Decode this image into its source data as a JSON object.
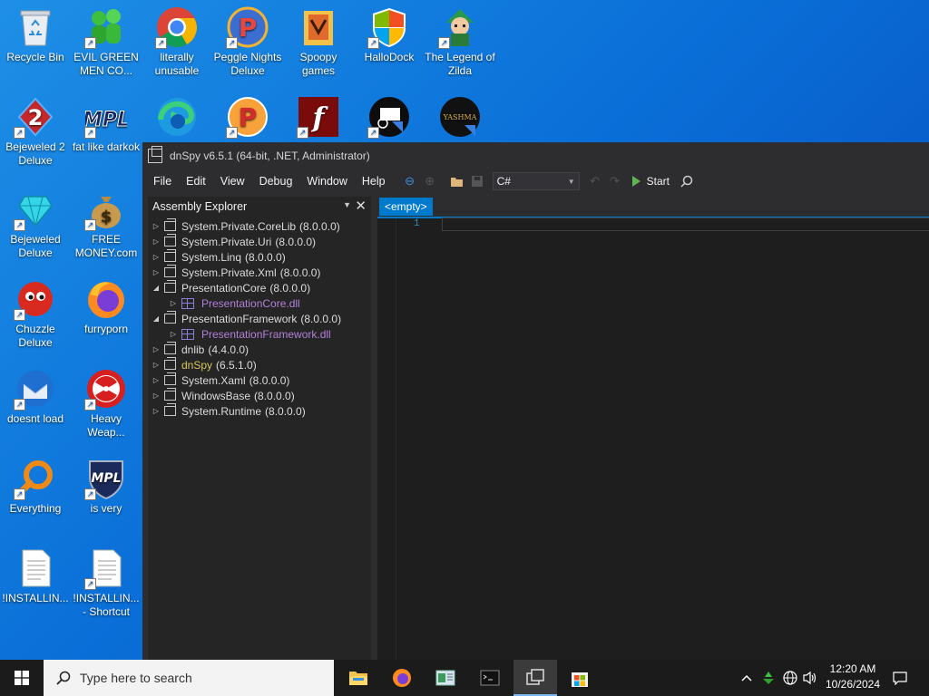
{
  "desktop": {
    "icons": [
      {
        "label": "Recycle Bin"
      },
      {
        "label": "EVIL GREEN MEN CO..."
      },
      {
        "label": "literally unusable"
      },
      {
        "label": "Peggle Nights Deluxe"
      },
      {
        "label": "Spoopy games"
      },
      {
        "label": "HalloDock"
      },
      {
        "label": "The Legend of Zilda"
      },
      {
        "label": "Bejeweled 2 Deluxe"
      },
      {
        "label": "fat like darkok"
      },
      {
        "label": "Bejeweled Deluxe"
      },
      {
        "label": "FREE MONEY.com"
      },
      {
        "label": "Chuzzle Deluxe"
      },
      {
        "label": "furryporn"
      },
      {
        "label": "doesnt load"
      },
      {
        "label": "Heavy Weap..."
      },
      {
        "label": "Everything"
      },
      {
        "label": "is very"
      },
      {
        "label": "!INSTALLIN..."
      },
      {
        "label": "!INSTALLIN... - Shortcut"
      }
    ],
    "icon_text": {
      "mpl": "MPL",
      "yashma": "YASHMA",
      "bejeweled_2": "2",
      "free_money_symbol": "$"
    }
  },
  "window": {
    "title": "dnSpy v6.5.1 (64-bit, .NET, Administrator)",
    "menu": [
      "File",
      "Edit",
      "View",
      "Debug",
      "Window",
      "Help"
    ],
    "language": "C#",
    "start_label": "Start"
  },
  "explorer": {
    "title": "Assembly Explorer",
    "items": [
      {
        "name": "System.Private.CoreLib",
        "version": "(8.0.0.0)",
        "level": 0,
        "expanded": false,
        "kind": "assembly"
      },
      {
        "name": "System.Private.Uri",
        "version": "(8.0.0.0)",
        "level": 0,
        "expanded": false,
        "kind": "assembly"
      },
      {
        "name": "System.Linq",
        "version": "(8.0.0.0)",
        "level": 0,
        "expanded": false,
        "kind": "assembly"
      },
      {
        "name": "System.Private.Xml",
        "version": "(8.0.0.0)",
        "level": 0,
        "expanded": false,
        "kind": "assembly"
      },
      {
        "name": "PresentationCore",
        "version": "(8.0.0.0)",
        "level": 0,
        "expanded": true,
        "kind": "assembly"
      },
      {
        "name": "PresentationCore.dll",
        "version": "",
        "level": 1,
        "expanded": false,
        "kind": "module"
      },
      {
        "name": "PresentationFramework",
        "version": "(8.0.0.0)",
        "level": 0,
        "expanded": true,
        "kind": "assembly"
      },
      {
        "name": "PresentationFramework.dll",
        "version": "",
        "level": 1,
        "expanded": false,
        "kind": "module"
      },
      {
        "name": "dnlib",
        "version": "(4.4.0.0)",
        "level": 0,
        "expanded": false,
        "kind": "assembly"
      },
      {
        "name": "dnSpy",
        "version": "(6.5.1.0)",
        "level": 0,
        "expanded": false,
        "kind": "assembly-highlight"
      },
      {
        "name": "System.Xaml",
        "version": "(8.0.0.0)",
        "level": 0,
        "expanded": false,
        "kind": "assembly"
      },
      {
        "name": "WindowsBase",
        "version": "(8.0.0.0)",
        "level": 0,
        "expanded": false,
        "kind": "assembly"
      },
      {
        "name": "System.Runtime",
        "version": "(8.0.0.0)",
        "level": 0,
        "expanded": false,
        "kind": "assembly"
      }
    ]
  },
  "editor": {
    "tab_label": "<empty>",
    "line_number": "1"
  },
  "taskbar": {
    "search_placeholder": "Type here to search",
    "time": "12:20 AM",
    "date": "10/26/2024"
  },
  "colors": {
    "accent": "#007acc",
    "module_text": "#b180d7",
    "highlight_text": "#d8c55a",
    "desktop": "#0a6fd8"
  }
}
